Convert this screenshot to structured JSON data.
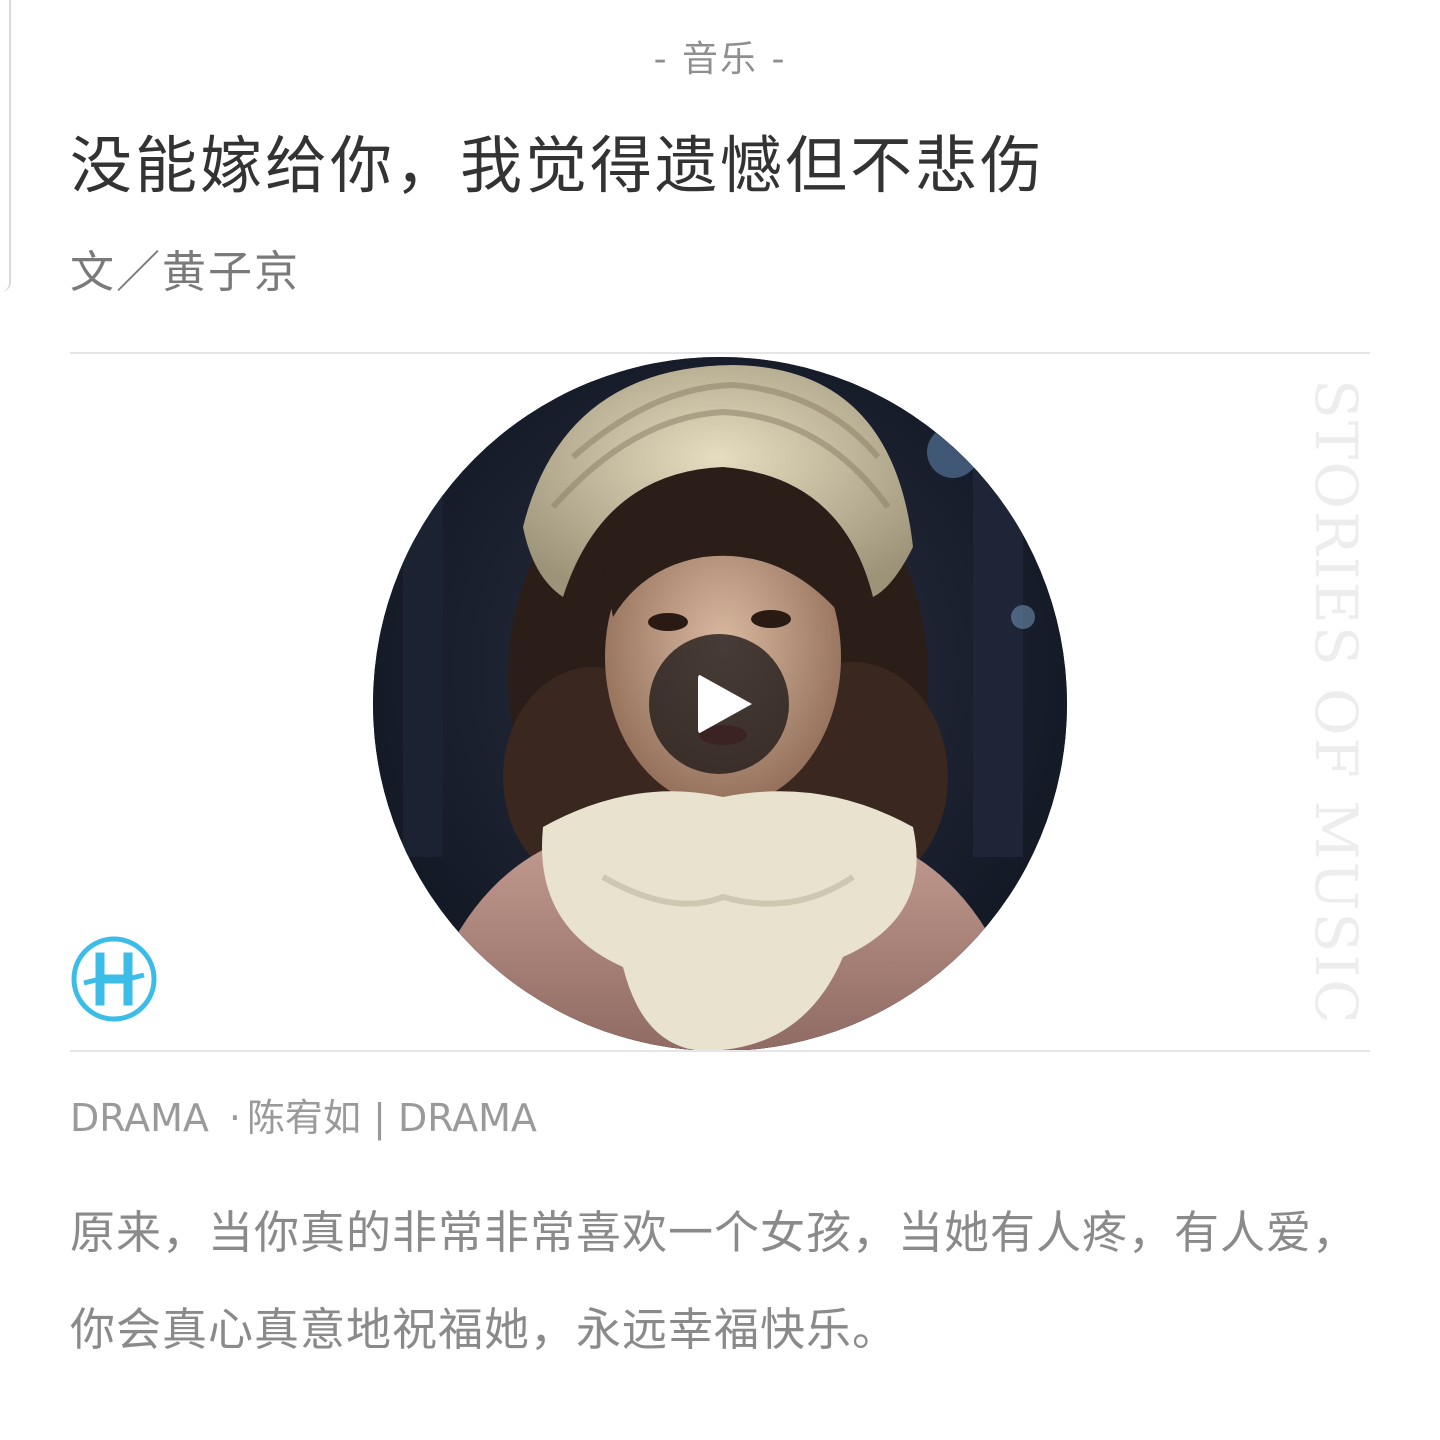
{
  "article": {
    "category": "- 音乐 -",
    "title": "没能嫁给你，我觉得遗憾但不悲伤",
    "byline": "文／黄子京",
    "side_text": "STORIES OF MUSIC",
    "media": {
      "play_icon": "play-icon",
      "brand_logo_icon": "brand-logo-icon"
    },
    "credit": {
      "source": "DRAMA",
      "separator": "·",
      "detail": "陈宥如 | DRAMA"
    },
    "paragraph": "原来，当你真的非常非常喜欢一个女孩，当她有人疼，有人爱，你会真心真意地祝福她，永远幸福快乐。"
  },
  "colors": {
    "title": "#333333",
    "category": "#8f8f8f",
    "body": "#8a8a8a",
    "credit": "#9a9a9a",
    "logo": "#3bbde8",
    "side_text": "#ededed"
  }
}
